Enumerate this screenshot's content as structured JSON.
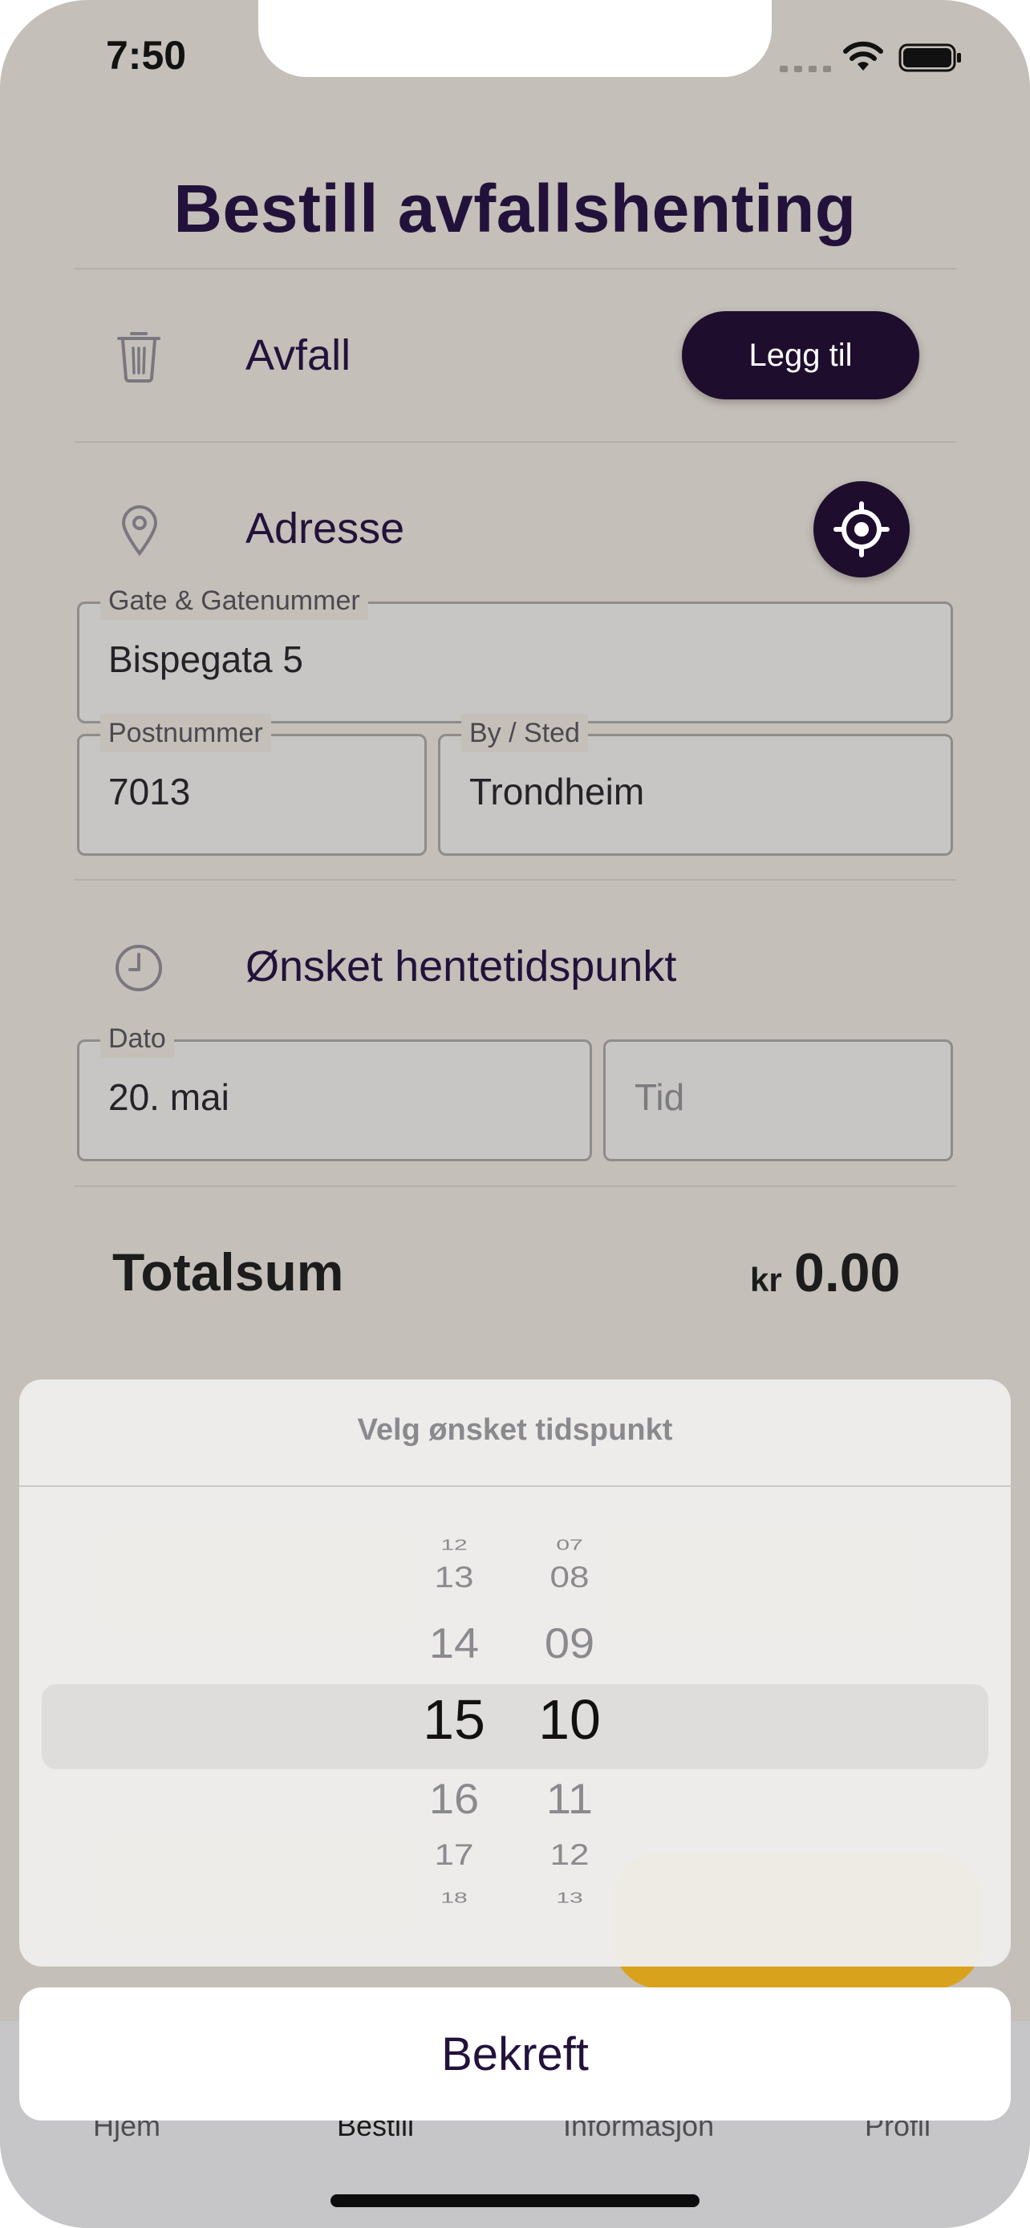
{
  "status_bar": {
    "time": "7:50"
  },
  "page": {
    "title": "Bestill avfallshenting"
  },
  "waste_section": {
    "label": "Avfall",
    "add_button": "Legg til"
  },
  "address_section": {
    "label": "Adresse",
    "street": {
      "label": "Gate & Gatenummer",
      "value": "Bispegata 5"
    },
    "postal": {
      "label": "Postnummer",
      "value": "7013"
    },
    "city": {
      "label": "By / Sted",
      "value": "Trondheim"
    }
  },
  "pickup_section": {
    "label": "Ønsket hentetidspunkt",
    "date": {
      "label": "Dato",
      "value": "20. mai"
    },
    "time": {
      "placeholder": "Tid"
    }
  },
  "total": {
    "label": "Totalsum",
    "currency": "kr",
    "amount": "0.00"
  },
  "time_picker": {
    "title": "Velg ønsket tidspunkt",
    "hours": [
      "12",
      "13",
      "14",
      "15",
      "16",
      "17",
      "18"
    ],
    "minutes": [
      "07",
      "08",
      "09",
      "10",
      "11",
      "12",
      "13"
    ],
    "selected_hour": "15",
    "selected_minute": "10",
    "confirm_label": "Bekreft"
  },
  "tab_bar": {
    "tabs": [
      {
        "label": "Hjem"
      },
      {
        "label": "Bestill"
      },
      {
        "label": "Informasjon"
      },
      {
        "label": "Profil"
      }
    ]
  },
  "colors": {
    "background": "#c4bfb8",
    "primary_dark": "#1e0d2c",
    "title_text": "#22123b",
    "accent_yellow": "#d9a21c"
  }
}
